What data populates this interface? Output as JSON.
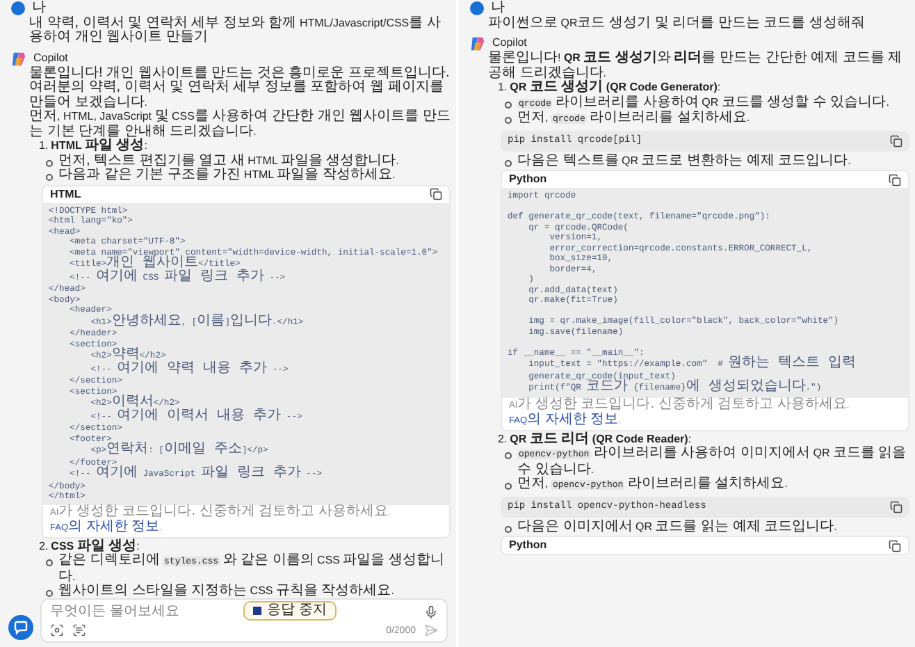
{
  "panels": [
    {
      "user": {
        "name": "나",
        "message": "내 약력, 이력서 및 연락처 세부 정보와 함께 HTML/Javascript/CSS를 사용하여 개인 웹사이트 만들기"
      },
      "assistant": {
        "name": "Copilot",
        "blocks": [
          {
            "kind": "paragraph",
            "text": "물론입니다! 개인 웹사이트를 만드는 것은 흥미로운 프로젝트입니다. 여러분의 약력, 이력서 및 연락처 세부 정보를 포함하여 웹 페이지를 만들어 보겠습니다."
          },
          {
            "kind": "paragraph",
            "text": "먼저, HTML, JavaScript 및 CSS를 사용하여 간단한 개인 웹사이트를 만드는 기본 단계를 안내해 드리겠습니다."
          },
          {
            "kind": "step",
            "number": "1.",
            "title": "**HTML 파일 생성**:"
          },
          {
            "kind": "bullet",
            "parts": [
              {
                "kind": "text",
                "text": "먼저, 텍스트 편집기를 열고 새 HTML 파일을 생성합니다."
              }
            ]
          },
          {
            "kind": "bullet",
            "parts": [
              {
                "kind": "text",
                "text": "다음과 같은 기본 구조를 가진 HTML 파일을 작성하세요."
              }
            ]
          },
          {
            "kind": "code",
            "language": "HTML",
            "code": "<!DOCTYPE html>\n<html lang=\"ko\">\n<head>\n    <meta charset=\"UTF-8\">\n    <meta name=\"viewport\" content=\"width=device-width, initial-scale=1.0\">\n    <title>개인 웹사이트</title>\n    <!-- 여기에 CSS 파일 링크 추가 -->\n</head>\n<body>\n    <header>\n        <h1>안녕하세요, [이름]입니다.</h1>\n    </header>\n    <section>\n        <h2>약력</h2>\n        <!-- 여기에 약력 내용 추가 -->\n    </section>\n    <section>\n        <h2>이력서</h2>\n        <!-- 여기에 이력서 내용 추가 -->\n    </section>\n    <footer>\n        <p>연락처: [이메일 주소]</p>\n    </footer>\n    <!-- 여기에 JavaScript 파일 링크 추가 -->\n</body>\n</html>",
            "note": {
              "text": "AI가 생성한 코드입니다. 신중하게 검토하고 사용하세요.",
              "link": "FAQ의 자세한 정보",
              "after": "."
            }
          },
          {
            "kind": "step",
            "number": "2.",
            "title": "**CSS 파일 생성**:"
          },
          {
            "kind": "bullet",
            "parts": [
              {
                "kind": "text",
                "text": "같은 디렉토리에 "
              },
              {
                "kind": "code",
                "text": "styles.css"
              },
              {
                "kind": "text",
                "text": " 와 같은 이름의 CSS 파일을 생성합니다."
              }
            ]
          },
          {
            "kind": "bullet",
            "parts": [
              {
                "kind": "text",
                "text": "웹사이트의 스타일을 지정하는 CSS 규칙을 작성하세요."
              }
            ]
          }
        ]
      }
    },
    {
      "user": {
        "name": "나",
        "message": "파이썬으로 QR코드 생성기 및 리더를 만드는 코드를 생성해줘"
      },
      "assistant": {
        "name": "Copilot",
        "blocks": [
          {
            "kind": "paragraph",
            "text": "물론입니다! **QR 코드 생성기**와 **리더**를 만드는 간단한 예제 코드를 제공해 드리겠습니다."
          },
          {
            "kind": "step",
            "number": "1.",
            "title": "**QR 코드 생성기 (QR Code Generator)**:"
          },
          {
            "kind": "bullet",
            "parts": [
              {
                "kind": "code",
                "text": "qrcode"
              },
              {
                "kind": "text",
                "text": " 라이브러리를 사용하여 QR 코드를 생성할 수 있습니다."
              }
            ]
          },
          {
            "kind": "bullet",
            "parts": [
              {
                "kind": "text",
                "text": "먼저, "
              },
              {
                "kind": "code",
                "text": "qrcode"
              },
              {
                "kind": "text",
                "text": " 라이브러리를 설치하세요."
              }
            ]
          },
          {
            "kind": "command",
            "code": "pip install qrcode[pil]"
          },
          {
            "kind": "bullet",
            "parts": [
              {
                "kind": "text",
                "text": "다음은 텍스트를 QR 코드로 변환하는 예제 코드입니다."
              }
            ]
          },
          {
            "kind": "code",
            "language": "Python",
            "code": "import qrcode\n\ndef generate_qr_code(text, filename=\"qrcode.png\"):\n    qr = qrcode.QRCode(\n        version=1,\n        error_correction=qrcode.constants.ERROR_CORRECT_L,\n        box_size=10,\n        border=4,\n    )\n    qr.add_data(text)\n    qr.make(fit=True)\n\n    img = qr.make_image(fill_color=\"black\", back_color=\"white\")\n    img.save(filename)\n\nif __name__ == \"__main__\":\n    input_text = \"https://example.com\"  # 원하는 텍스트 입력\n    generate_qr_code(input_text)\n    print(f\"QR 코드가 {filename}에 생성되었습니다.\")",
            "note": {
              "text": "AI가 생성한 코드입니다. 신중하게 검토하고 사용하세요.",
              "link": "FAQ의 자세한 정보",
              "after": "."
            }
          },
          {
            "kind": "step",
            "number": "2.",
            "title": "**QR 코드 리더 (QR Code Reader)**:"
          },
          {
            "kind": "bullet",
            "parts": [
              {
                "kind": "code",
                "text": "opencv-python"
              },
              {
                "kind": "text",
                "text": " 라이브러리를 사용하여 이미지에서 QR 코드를 읽을 수 있습니다."
              }
            ]
          },
          {
            "kind": "bullet",
            "parts": [
              {
                "kind": "text",
                "text": "먼저, "
              },
              {
                "kind": "code",
                "text": "opencv-python"
              },
              {
                "kind": "text",
                "text": " 라이브러리를 설치하세요."
              }
            ]
          },
          {
            "kind": "command",
            "code": "pip install opencv-python-headless"
          },
          {
            "kind": "bullet",
            "parts": [
              {
                "kind": "text",
                "text": "다음은 이미지에서 QR 코드를 읽는 예제 코드입니다."
              }
            ]
          },
          {
            "kind": "code",
            "language": "Python"
          }
        ]
      }
    }
  ],
  "composer": {
    "placeholder": "무엇이든 물어보세요",
    "counter": "0/2000"
  },
  "stop_button": {
    "label": "응답 중지"
  }
}
